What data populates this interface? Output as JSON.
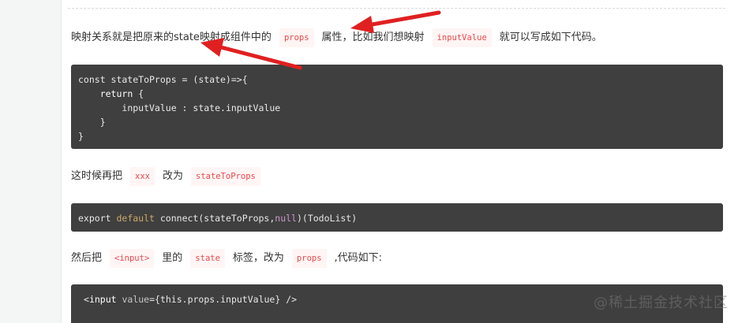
{
  "para1": {
    "before": "映射关系就是把原来的state映射成组件中的",
    "code1": "props",
    "middle": "属性，比如我们想映射",
    "code2": "inputValue",
    "after": "就可以写成如下代码。"
  },
  "code1": {
    "line1_a": "const stateToProps = (state)=>{",
    "line2_kw": "return",
    "line2_rest": " {",
    "line3_a": "inputValue : state.inputValue",
    "line4": "}",
    "line5": "}"
  },
  "para2": {
    "before": "这时候再把",
    "code1": "xxx",
    "middle": "改为",
    "code2": "stateToProps"
  },
  "code2": {
    "kw1": "export",
    "kw2": "default",
    "rest_a": " connect(stateToProps,",
    "null": "null",
    "rest_b": ")(TodoList)"
  },
  "para3": {
    "before": "然后把",
    "code1": "<input>",
    "middle1": "里的",
    "code2": "state",
    "middle2": "标签，改为",
    "code3": "props",
    "after": ",代码如下:"
  },
  "code3": {
    "open": "<",
    "tag": "input",
    "attr": " value",
    "rest": "={this.props.inputValue} />"
  },
  "watermark": "@稀土掘金技术社区",
  "colors": {
    "arrow": "#e02020",
    "code_bg": "#3f3f3f",
    "inline_code": "#e9484a"
  }
}
